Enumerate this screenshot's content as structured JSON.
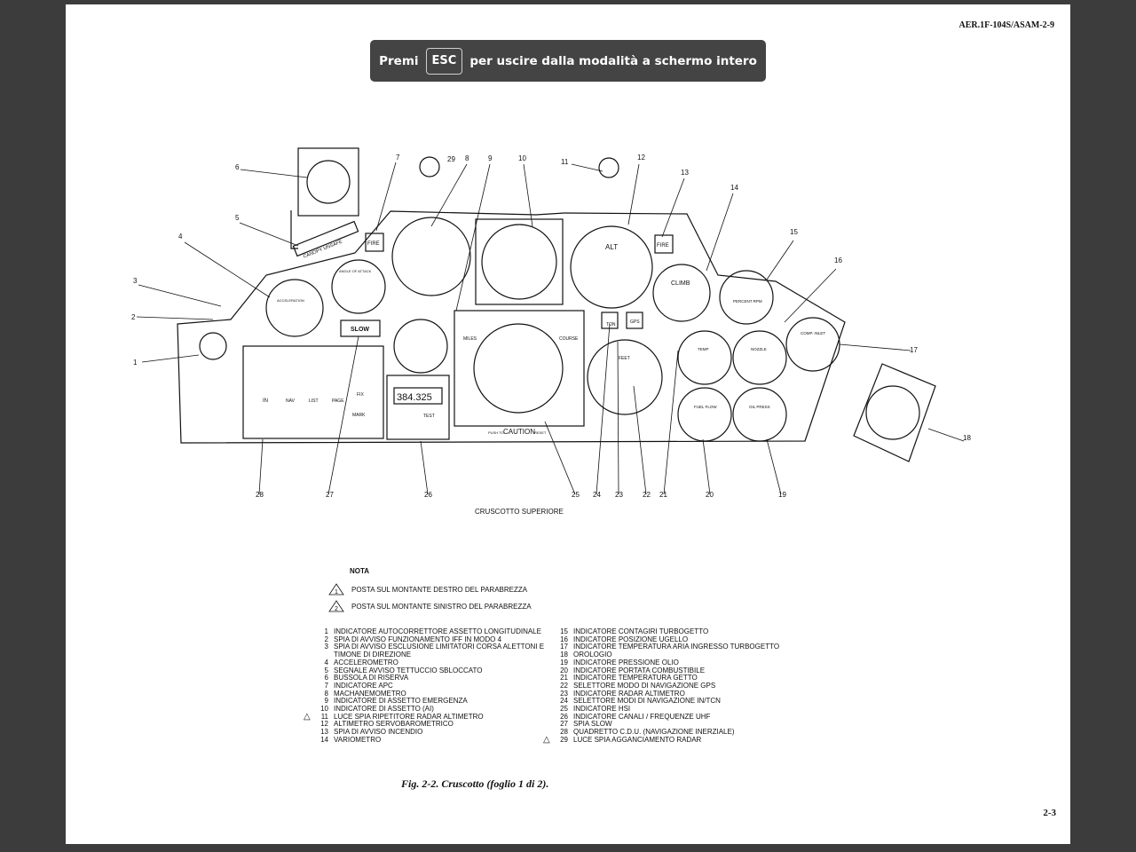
{
  "header": {
    "doc_code": "AER.1F-104S/ASAM-2-9"
  },
  "fullscreen_notice": {
    "prefix": "Premi",
    "key": "ESC",
    "suffix": "per uscire dalla modalità a schermo intero"
  },
  "diagram": {
    "subtitle": "CRUSCOTTO SUPERIORE",
    "callouts": [
      "1",
      "2",
      "3",
      "4",
      "5",
      "6",
      "7",
      "8",
      "9",
      "10",
      "11",
      "12",
      "13",
      "14",
      "15",
      "16",
      "17",
      "18",
      "19",
      "20",
      "21",
      "22",
      "23",
      "24",
      "25",
      "26",
      "27",
      "28",
      "29"
    ],
    "panel_labels": {
      "fire_left": "FIRE",
      "fire_right": "FIRE",
      "alt": "ALT",
      "climb": "CLIMB",
      "slow": "SLOW",
      "canopy": "CANOPY UNSAFE",
      "caution": "CAUTION",
      "push_to": "PUSH TO",
      "reset": "RESET",
      "uhf_display": "384.325",
      "btn_in": "IN",
      "btn_nav": "NAV",
      "btn_list": "LIST",
      "btn_page": "PAGE",
      "btn_fix": "FIX",
      "btn_mark": "MARK",
      "ton": "TON",
      "gps": "GPS",
      "feet": "FEET",
      "test": "TEST",
      "course": "COURSE",
      "miles": "MILES",
      "temp": "TEMP",
      "nozzle": "NOZZLE",
      "fuel_flow": "FUEL FLOW",
      "oil_press": "OIL PRESS",
      "comp_inlet": "COMP. INLET",
      "percent_rpm": "PERCENT RPM",
      "accel": "ACCELERATION",
      "aoa": "ANGLE OF ATTACK"
    }
  },
  "nota": {
    "title": "NOTA",
    "items": [
      {
        "mark": "1",
        "text": "POSTA SUL MONTANTE DESTRO DEL PARABREZZA"
      },
      {
        "mark": "2",
        "text": "POSTA SUL MONTANTE SINISTRO DEL PARABREZZA"
      }
    ]
  },
  "legend": {
    "left": [
      {
        "n": "1",
        "text": "INDICATORE AUTOCORRETTORE ASSETTO LONGITUDINALE"
      },
      {
        "n": "2",
        "text": "SPIA DI AVVISO FUNZIONAMENTO IFF IN MODO 4"
      },
      {
        "n": "3",
        "text": "SPIA DI AVVISO ESCLUSIONE LIMITATORI CORSA ALETTONI E"
      },
      {
        "n": "",
        "text": "TIMONE  DI DIREZIONE"
      },
      {
        "n": "4",
        "text": "ACCELEROMETRO"
      },
      {
        "n": "5",
        "text": "SEGNALE AVVISO TETTUCCIO SBLOCCATO"
      },
      {
        "n": "6",
        "text": "BUSSOLA DI RISERVA"
      },
      {
        "n": "7",
        "text": "INDICATORE APC"
      },
      {
        "n": "8",
        "text": "MACHANEMOMETRO"
      },
      {
        "n": "9",
        "text": "INDICATORE DI ASSETTO EMERGENZA"
      },
      {
        "n": "10",
        "text": "INDICATORE DI ASSETTO (AI)"
      },
      {
        "n": "11",
        "text": "LUCE SPIA RIPETITORE RADAR ALTIMETRO",
        "mark": "1"
      },
      {
        "n": "12",
        "text": "ALTIMETRO SERVOBAROMETRICO"
      },
      {
        "n": "13",
        "text": "SPIA DI AVVISO INCENDIO"
      },
      {
        "n": "14",
        "text": "VARIOMETRO"
      }
    ],
    "right": [
      {
        "n": "15",
        "text": "INDICATORE CONTAGIRI TURBOGETTO"
      },
      {
        "n": "16",
        "text": "INDICATORE POSIZIONE UGELLO"
      },
      {
        "n": "17",
        "text": "INDICATORE TEMPERATURA ARIA INGRESSO TURBOGETTO"
      },
      {
        "n": "18",
        "text": "OROLOGIO"
      },
      {
        "n": "19",
        "text": "INDICATORE PRESSIONE OLIO"
      },
      {
        "n": "20",
        "text": "INDICATORE PORTATA COMBUSTIBILE"
      },
      {
        "n": "21",
        "text": "INDICATORE TEMPERATURA GETTO"
      },
      {
        "n": "22",
        "text": "SELETTORE MODO DI NAVIGAZIONE GPS"
      },
      {
        "n": "23",
        "text": "INDICATORE RADAR ALTIMETRO"
      },
      {
        "n": "24",
        "text": "SELETTORE MODI DI NAVIGAZIONE IN/TCN"
      },
      {
        "n": "25",
        "text": "INDICATORE HSI"
      },
      {
        "n": "26",
        "text": "INDICATORE CANALI / FREQUENZE UHF"
      },
      {
        "n": "27",
        "text": "SPIA SLOW"
      },
      {
        "n": "28",
        "text": "QUADRETTO C.D.U. (NAVIGAZIONE INERZIALE)"
      },
      {
        "n": "29",
        "text": "LUCE SPIA AGGANCIAMENTO RADAR",
        "mark": "2"
      }
    ]
  },
  "caption": "Fig. 2-2. Cruscotto (foglio 1 di 2).",
  "page_number": "2-3"
}
